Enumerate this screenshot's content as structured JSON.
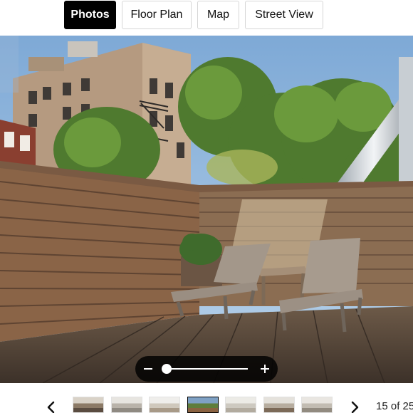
{
  "tabs": [
    {
      "label": "Photos",
      "active": true
    },
    {
      "label": "Floor Plan",
      "active": false
    },
    {
      "label": "Map",
      "active": false
    },
    {
      "label": "Street View",
      "active": false
    }
  ],
  "photo": {
    "subject": "rooftop-deck-with-lounge-chairs"
  },
  "zoom": {
    "out_icon": "minus-icon",
    "in_icon": "plus-icon",
    "level": 0
  },
  "gallery": {
    "prev_icon": "chevron-left-icon",
    "next_icon": "chevron-right-icon",
    "counter": "15 of 25",
    "current_index": 15,
    "total": 25,
    "thumbnails": [
      {
        "colors": [
          "#d9d2c7",
          "#8c7a66",
          "#5a4c40"
        ]
      },
      {
        "colors": [
          "#e7e5e0",
          "#b9b3aa",
          "#8f8a82"
        ]
      },
      {
        "colors": [
          "#efeeeb",
          "#cfc8bc",
          "#a89a88"
        ]
      },
      {
        "colors": [
          "#7fa1c4",
          "#5f7d3b",
          "#8a6240"
        ],
        "active": true
      },
      {
        "colors": [
          "#ecebe6",
          "#cdc9c0",
          "#b2ab9f"
        ]
      },
      {
        "colors": [
          "#e5e2dc",
          "#b7ad9f",
          "#7c6a58"
        ]
      },
      {
        "colors": [
          "#e9e6e1",
          "#c2bcb2",
          "#928b80"
        ]
      }
    ]
  }
}
